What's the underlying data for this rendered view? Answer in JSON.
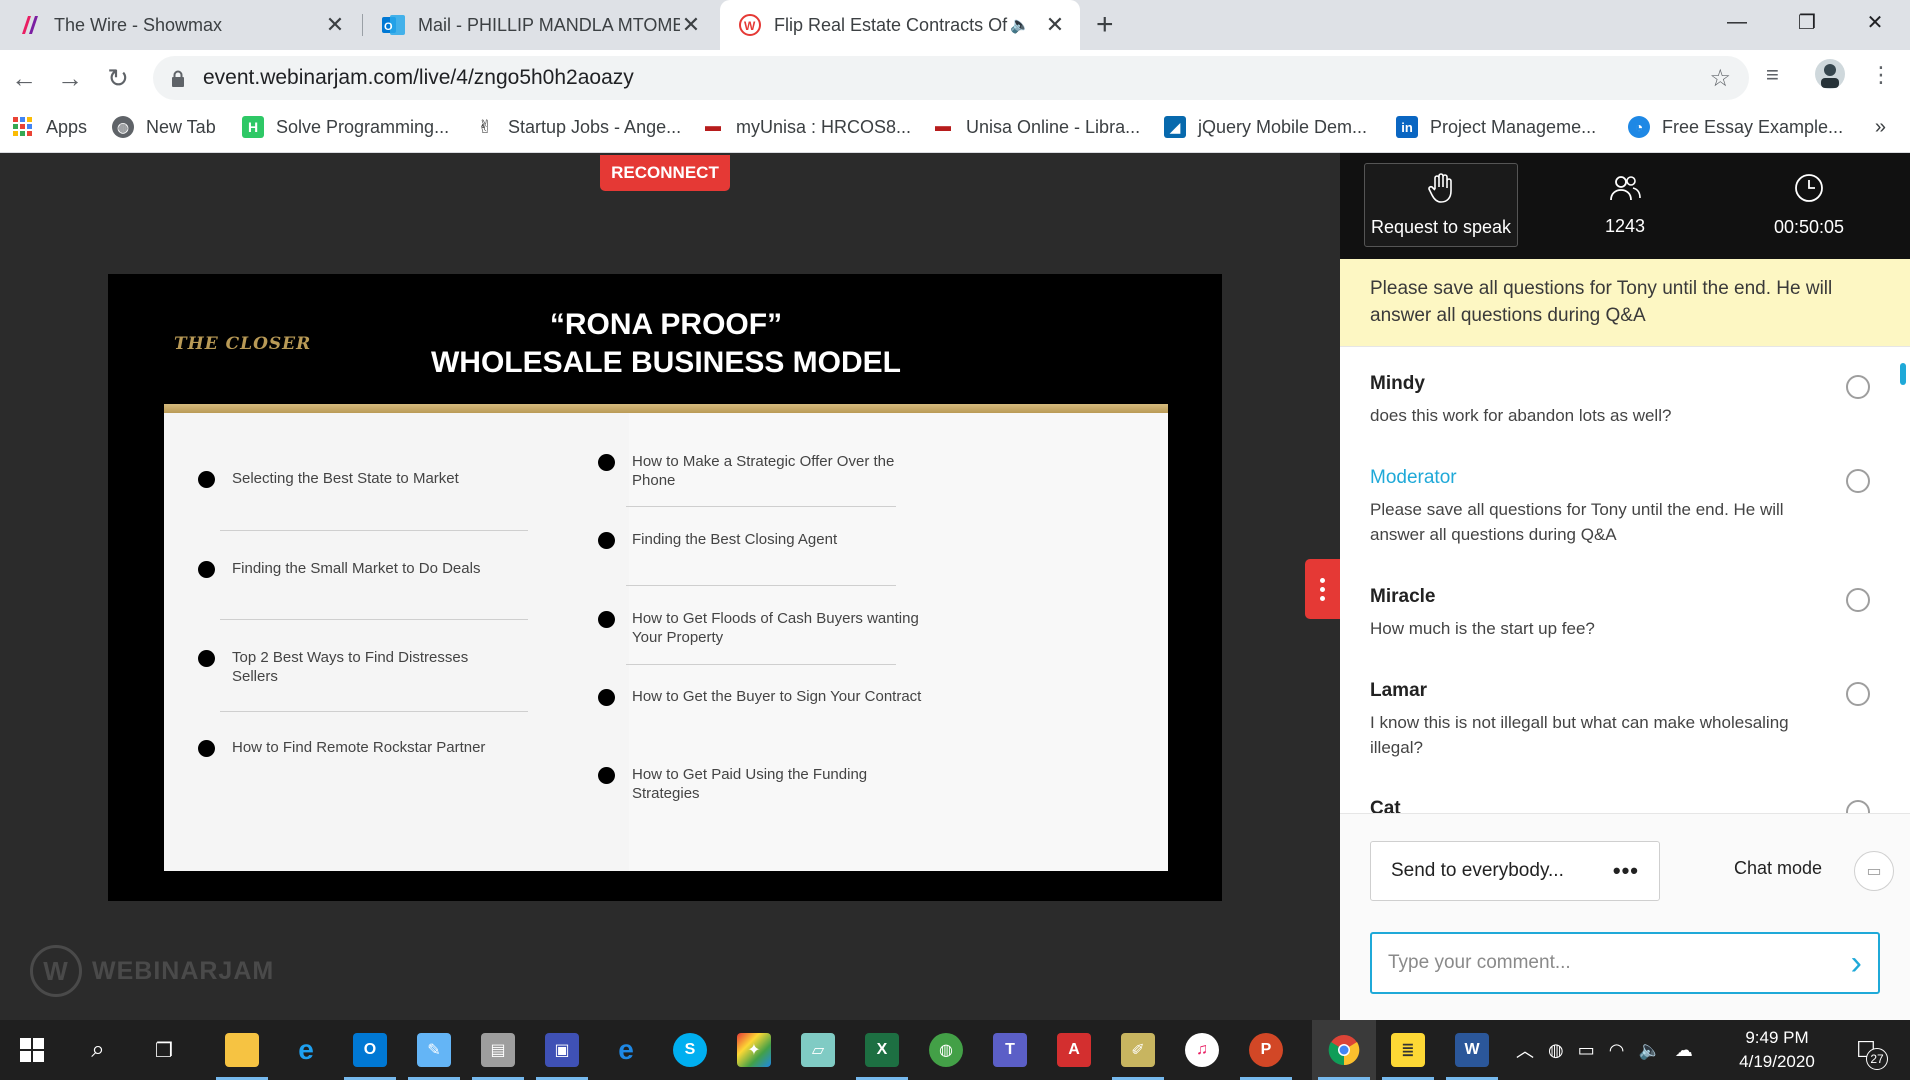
{
  "browser": {
    "tabs": [
      {
        "title": "The Wire - Showmax",
        "icon": "showmax-icon",
        "color": "#e91e63"
      },
      {
        "title": "Mail - PHILLIP MANDLA MTOMB",
        "icon": "outlook-icon",
        "color": "#0078d4"
      },
      {
        "title": "Flip Real Estate Contracts Of",
        "icon": "webinarjam-icon",
        "color": "#e53935"
      }
    ],
    "new_tab": "+",
    "url": "event.webinarjam.com/live/4/zngo5h0h2aoazy",
    "bookmarks": [
      {
        "label": "Apps",
        "icon": "apps-grid-icon"
      },
      {
        "label": "New Tab",
        "icon": "globe-icon"
      },
      {
        "label": "Solve Programming...",
        "icon": "hackerrank-icon"
      },
      {
        "label": "Startup Jobs - Ange...",
        "icon": "angellist-icon"
      },
      {
        "label": "myUnisa : HRCOS8...",
        "icon": "unisa-icon"
      },
      {
        "label": "Unisa Online - Libra...",
        "icon": "unisa-icon"
      },
      {
        "label": "jQuery Mobile Dem...",
        "icon": "jquery-icon"
      },
      {
        "label": "Project Manageme...",
        "icon": "linkedin-icon"
      },
      {
        "label": "Free Essay Example...",
        "icon": "bulb-icon"
      }
    ],
    "more": "»"
  },
  "stage": {
    "reconnect_label": "RECONNECT",
    "slide": {
      "logo": "THE CLOSER",
      "title_line1": "“RONA PROOF”",
      "title_line2": "WHOLESALE BUSINESS MODEL",
      "left_items": [
        "Selecting the Best State to Market",
        "Finding the Small Market to Do Deals",
        "Top 2 Best Ways to Find Distresses Sellers",
        "How to Find Remote Rockstar Partner"
      ],
      "right_items": [
        "How to Make a Strategic Offer Over the Phone",
        "Finding the Best Closing Agent",
        "How to Get Floods of Cash Buyers wanting Your Property",
        "How to Get the Buyer to Sign Your Contract",
        "How to Get Paid Using the Funding Strategies"
      ]
    },
    "watermark": "WEBINARJAM"
  },
  "panel": {
    "request_label": "Request to speak",
    "attendees": "1243",
    "elapsed": "00:50:05",
    "notice": "Please save all questions for Tony until the end. He will answer all questions during Q&A",
    "messages": [
      {
        "author": "Mindy",
        "text": "does this work for abandon lots as well?"
      },
      {
        "author": "Moderator",
        "text": "Please save all questions for Tony until the end. He will answer all questions during Q&A"
      },
      {
        "author": "Miracle",
        "text": "How much is the start up fee?"
      },
      {
        "author": "Lamar",
        "text": "I know this is not illegall but what can make wholesaling illegal?"
      },
      {
        "author": "Cat",
        "text": ""
      }
    ],
    "send_to": "Send to everybody...",
    "chat_mode": "Chat mode",
    "comment_placeholder": "Type your comment..."
  },
  "taskbar": {
    "time": "9:49 PM",
    "date": "4/19/2020",
    "notification_count": "27"
  },
  "colors": {
    "accent": "#1fa9d8",
    "reconnect": "#e53935",
    "notice_bg": "#fdf7c3",
    "slide_gold": "#b99a56"
  }
}
